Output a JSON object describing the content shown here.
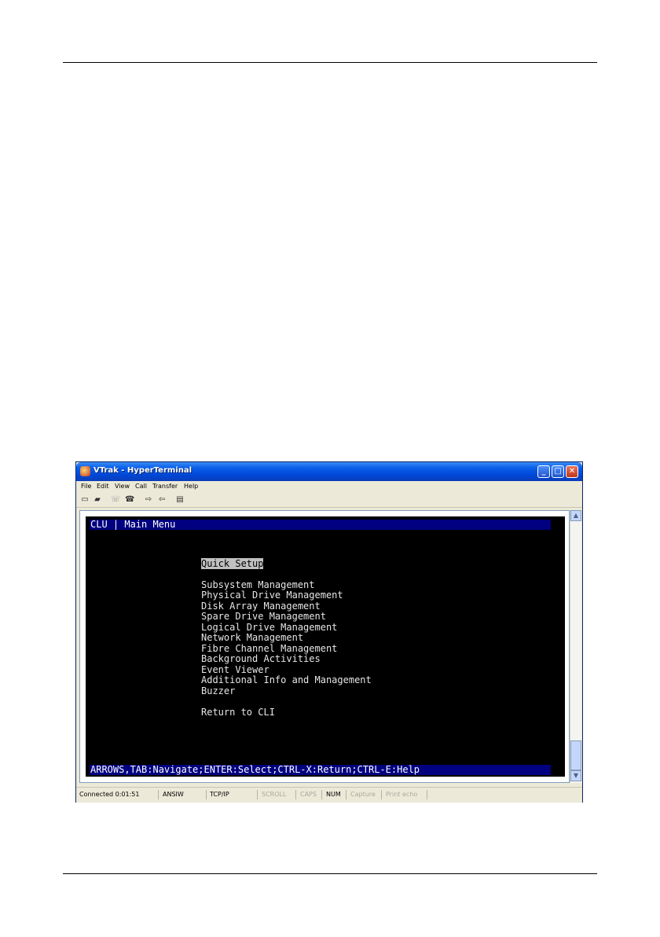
{
  "window": {
    "title": "VTrak - HyperTerminal",
    "controls": {
      "minimize": "_",
      "maximize": "□",
      "close": "✕"
    }
  },
  "menubar": [
    "File",
    "Edit",
    "View",
    "Call",
    "Transfer",
    "Help"
  ],
  "toolbar_icons": [
    "new-icon",
    "open-icon",
    "disconnect-icon",
    "dial-icon",
    "send-icon",
    "receive-icon",
    "properties-icon"
  ],
  "terminal": {
    "header": "CLU | Main Menu",
    "selected_item": "Quick Setup",
    "menu_items": [
      "Subsystem Management",
      "Physical Drive Management",
      "Disk Array Management",
      "Spare Drive Management",
      "Logical Drive Management",
      "Network Management",
      "Fibre Channel Management",
      "Background Activities",
      "Event Viewer",
      "Additional Info and Management",
      "Buzzer"
    ],
    "return_item": "Return to CLI",
    "footer": "ARROWS,TAB:Navigate;ENTER:Select;CTRL-X:Return;CTRL-E:Help"
  },
  "statusbar": {
    "connected": "Connected 0:01:51",
    "emulation": "ANSIW",
    "protocol": "TCP/IP",
    "scroll": "SCROLL",
    "caps": "CAPS",
    "num": "NUM",
    "capture": "Capture",
    "print_echo": "Print echo"
  }
}
